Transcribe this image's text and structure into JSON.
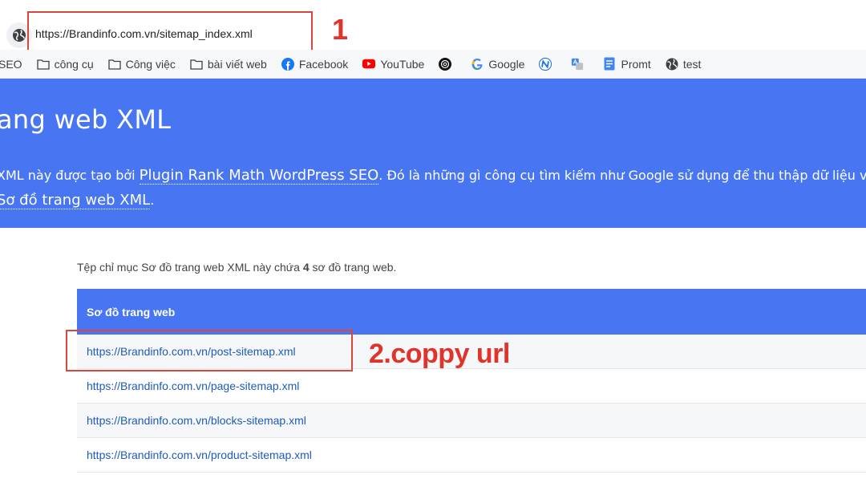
{
  "browser": {
    "url": "https://Brandinfo.com.vn/sitemap_index.xml"
  },
  "annotations": {
    "step1": "1",
    "step2": "2.coppy url",
    "color": "#e0342a"
  },
  "bookmarks": [
    {
      "label": "SEO",
      "icon": "folder-icon"
    },
    {
      "label": "công cụ",
      "icon": "folder-icon"
    },
    {
      "label": "Công việc",
      "icon": "folder-icon"
    },
    {
      "label": "bài viết web",
      "icon": "folder-icon"
    },
    {
      "label": "Facebook",
      "icon": "facebook-icon"
    },
    {
      "label": "YouTube",
      "icon": "youtube-icon"
    },
    {
      "label": "",
      "icon": "openai-icon"
    },
    {
      "label": "Google",
      "icon": "google-icon"
    },
    {
      "label": "",
      "icon": "n-icon"
    },
    {
      "label": "",
      "icon": "translate-icon"
    },
    {
      "label": "Promt",
      "icon": "doc-icon"
    },
    {
      "label": "test",
      "icon": "globe-icon"
    }
  ],
  "hero": {
    "title": "ang web XML",
    "line1_pre": "XML này được tạo bởi ",
    "line1_link": "Plugin Rank Math WordPress SEO",
    "line1_post": ". Đó là những gì công cụ tìm kiếm như Google sử dụng để thu thập dữ liệu và th",
    "line2_link": "Sơ đồ trang web XML",
    "line2_post": ".",
    "bg_color": "#4876f3"
  },
  "content": {
    "intro_pre": "Tệp chỉ mục Sơ đồ trang web XML này chứa ",
    "intro_count": "4",
    "intro_post": " sơ đồ trang web.",
    "table_header": "Sơ đồ trang web",
    "rows": [
      "https://Brandinfo.com.vn/post-sitemap.xml",
      "https://Brandinfo.com.vn/page-sitemap.xml",
      "https://Brandinfo.com.vn/blocks-sitemap.xml",
      "https://Brandinfo.com.vn/product-sitemap.xml"
    ]
  }
}
